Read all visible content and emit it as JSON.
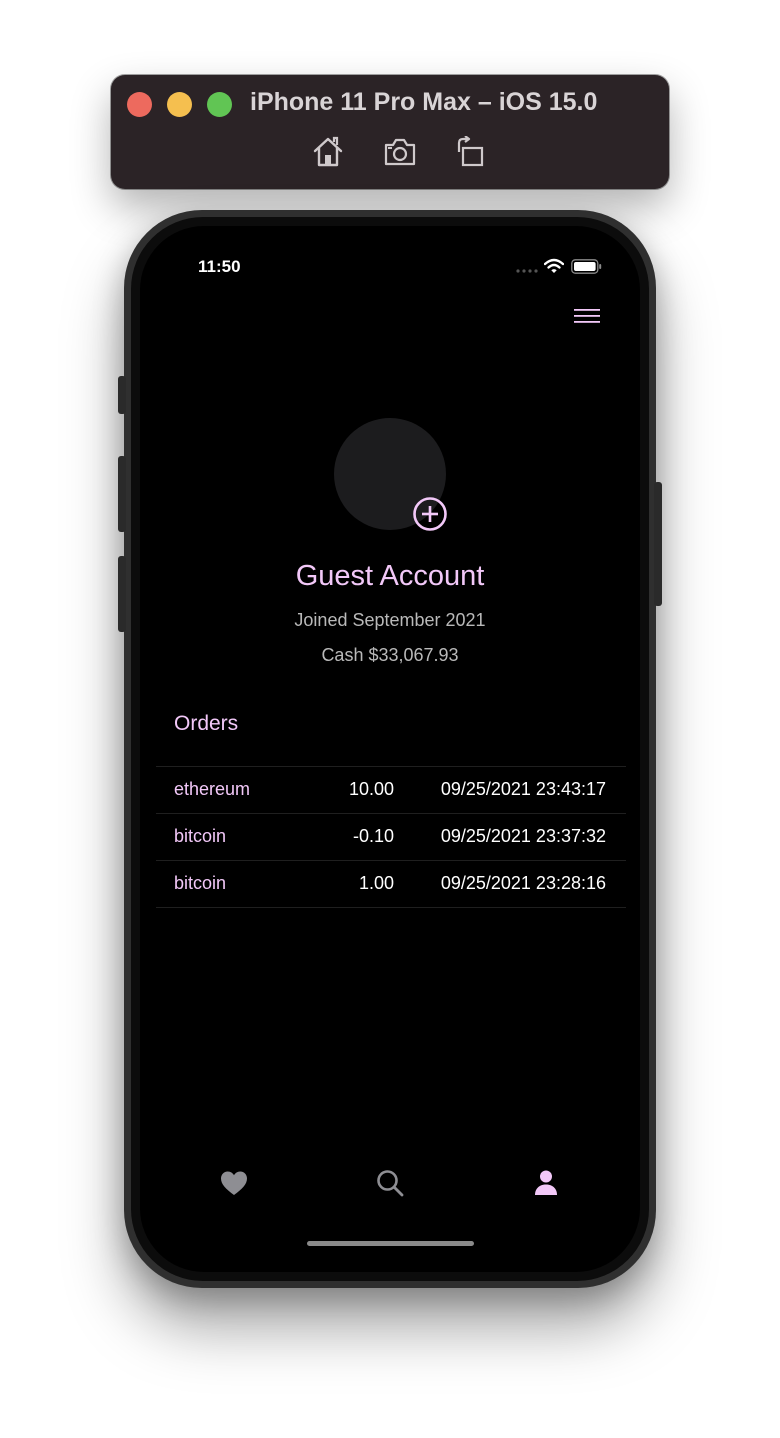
{
  "simulator": {
    "title": "iPhone 11 Pro Max – iOS 15.0",
    "buttons": [
      "home-icon",
      "screenshot-icon",
      "rotate-icon"
    ]
  },
  "status_bar": {
    "time": "11:50"
  },
  "profile": {
    "name": "Guest Account",
    "joined": "Joined September 2021",
    "cash": "Cash $33,067.93"
  },
  "orders": {
    "title": "Orders",
    "rows": [
      {
        "coin": "ethereum",
        "amount": "10.00",
        "time": "09/25/2021 23:43:17"
      },
      {
        "coin": "bitcoin",
        "amount": "-0.10",
        "time": "09/25/2021 23:37:32"
      },
      {
        "coin": "bitcoin",
        "amount": "1.00",
        "time": "09/25/2021 23:28:16"
      }
    ]
  },
  "tab_bar": {
    "items": [
      {
        "icon": "heart-icon",
        "color": "#8e8e93"
      },
      {
        "icon": "search-icon",
        "color": "#8e8e93"
      },
      {
        "icon": "person-icon",
        "color": "#f2c8f8",
        "selected": true
      }
    ]
  },
  "colors": {
    "accent": "#f2c8f8",
    "background": "#000000",
    "secondary_text": "#b9b9b9",
    "inactive_tab": "#8e8e93"
  }
}
